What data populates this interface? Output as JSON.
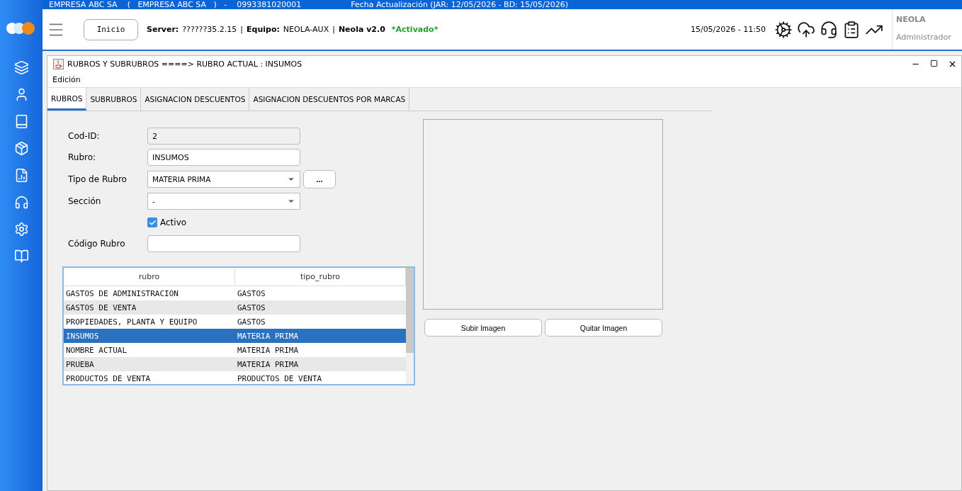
{
  "top_bar": {
    "company": "EMPRESA ABC SA    (   EMPRESA ABC SA   )   -    0993381020001",
    "update_info": "Fecha Actualización (JAR: 12/05/2026 - BD: 15/05/2026)"
  },
  "header": {
    "home_button": "Inicio",
    "server_label": "Server:",
    "server": "??????35.2.15",
    "sep1": "|",
    "team_label": "Equipo:",
    "team": "NEOLA-AUX",
    "sep2": "|",
    "version": "Neola v2.0",
    "status": "*Activado*",
    "datetime": "15/05/2026 - 11:50",
    "user": "NEOLA",
    "role": "Administrador"
  },
  "window": {
    "title": "RUBROS Y SUBRUBROS ====> RUBRO ACTUAL : INSUMOS",
    "menu": [
      "Edición"
    ]
  },
  "tabs": [
    {
      "label": "RUBROS",
      "selected": true
    },
    {
      "label": "SUBRUBROS",
      "selected": false
    },
    {
      "label": "ASIGNACION DESCUENTOS",
      "selected": false
    },
    {
      "label": "ASIGNACION DESCUENTOS POR MARCAS",
      "selected": false
    }
  ],
  "form": {
    "fields": [
      {
        "kind": "text",
        "label": "Cod-ID:",
        "value": "2",
        "disabled": true
      },
      {
        "kind": "text",
        "label": "Rubro:",
        "value": "INSUMOS",
        "disabled": false
      },
      {
        "kind": "select",
        "label": "Tipo de Rubro",
        "value": "MATERIA PRIMA",
        "extra_button": "..."
      },
      {
        "kind": "select",
        "label": "Sección",
        "value": "-"
      },
      {
        "kind": "checkbox",
        "label": "Activo",
        "checked": true
      },
      {
        "kind": "text",
        "label": "Código Rubro",
        "disabled": false
      }
    ]
  },
  "table": {
    "columns": [
      "rubro",
      "tipo_rubro"
    ],
    "rows": [
      {
        "cells": [
          "GASTOS DE ADMINISTRACION",
          "GASTOS"
        ],
        "selected": false
      },
      {
        "cells": [
          "GASTOS DE VENTA",
          "GASTOS"
        ],
        "selected": false
      },
      {
        "cells": [
          "PROPIEDADES, PLANTA Y EQUIPO",
          "GASTOS"
        ],
        "selected": false
      },
      {
        "cells": [
          "INSUMOS",
          "MATERIA PRIMA"
        ],
        "selected": true
      },
      {
        "cells": [
          "NOMBRE ACTUAL",
          "MATERIA PRIMA"
        ],
        "selected": false
      },
      {
        "cells": [
          "PRUEBA",
          "MATERIA PRIMA"
        ],
        "selected": false
      },
      {
        "cells": [
          "PRODUCTOS DE VENTA",
          "PRODUCTOS DE VENTA"
        ],
        "selected": false
      }
    ]
  },
  "image_buttons": [
    "Subir Imagen",
    "Quitar Imagen"
  ]
}
